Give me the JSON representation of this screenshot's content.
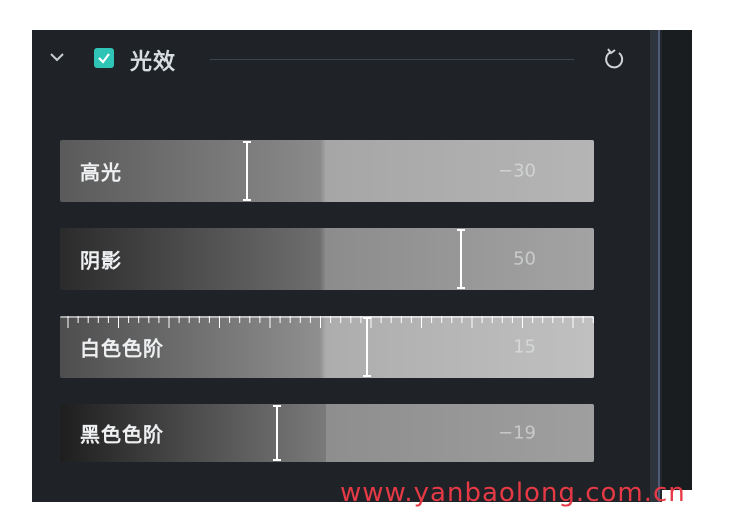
{
  "section": {
    "title": "光效",
    "enabled": true,
    "collapse_icon": "chevron-down-icon",
    "reset_icon": "reset-icon"
  },
  "sliders": [
    {
      "label": "高光",
      "value": "−30"
    },
    {
      "label": "阴影",
      "value": "50"
    },
    {
      "label": "白色色阶",
      "value": "15"
    },
    {
      "label": "黑色色阶",
      "value": "−19"
    }
  ],
  "watermark": {
    "text": "www.yanbaolong.com.cn"
  },
  "colors": {
    "panel_bg": "#1f2327",
    "checkbox_accent": "#2ec4b6",
    "watermark": "#e53946"
  }
}
